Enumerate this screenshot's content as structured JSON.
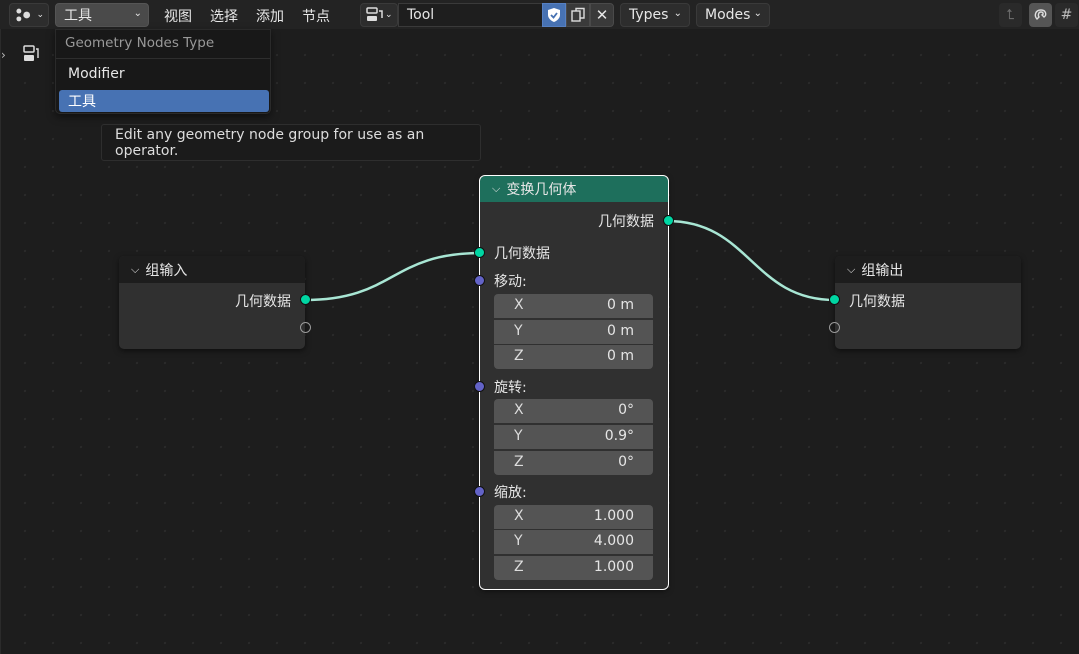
{
  "header": {
    "tool_select": "工具",
    "menus": [
      "视图",
      "选择",
      "添加",
      "节点"
    ],
    "node_tree_name": "Tool",
    "types_label": "Types",
    "modes_label": "Modes"
  },
  "dropdown": {
    "title": "Geometry Nodes Type",
    "items": [
      {
        "label": "Modifier",
        "selected": false
      },
      {
        "label": "工具",
        "selected": true
      }
    ]
  },
  "tooltip": "Edit any geometry node group for use as an operator.",
  "nodes": {
    "group_input": {
      "title": "组输入",
      "output": "几何数据"
    },
    "group_output": {
      "title": "组输出",
      "input": "几何数据"
    },
    "transform": {
      "title": "变换几何体",
      "output": "几何数据",
      "input": "几何数据",
      "translation": {
        "label": "移动:",
        "x_label": "X",
        "x": "0 m",
        "y_label": "Y",
        "y": "0 m",
        "z_label": "Z",
        "z": "0 m"
      },
      "rotation": {
        "label": "旋转:",
        "x_label": "X",
        "x": "0°",
        "y_label": "Y",
        "y": "0.9°",
        "z_label": "Z",
        "z": "0°"
      },
      "scale": {
        "label": "缩放:",
        "x_label": "X",
        "x": "1.000",
        "y_label": "Y",
        "y": "4.000",
        "z_label": "Z",
        "z": "1.000"
      }
    }
  },
  "colors": {
    "geometry_socket": "#00d6a3",
    "vector_socket": "#6363c7",
    "link": "#a8e6d4",
    "transform_header": "#1e6f5c",
    "selection": "#4772b3"
  }
}
